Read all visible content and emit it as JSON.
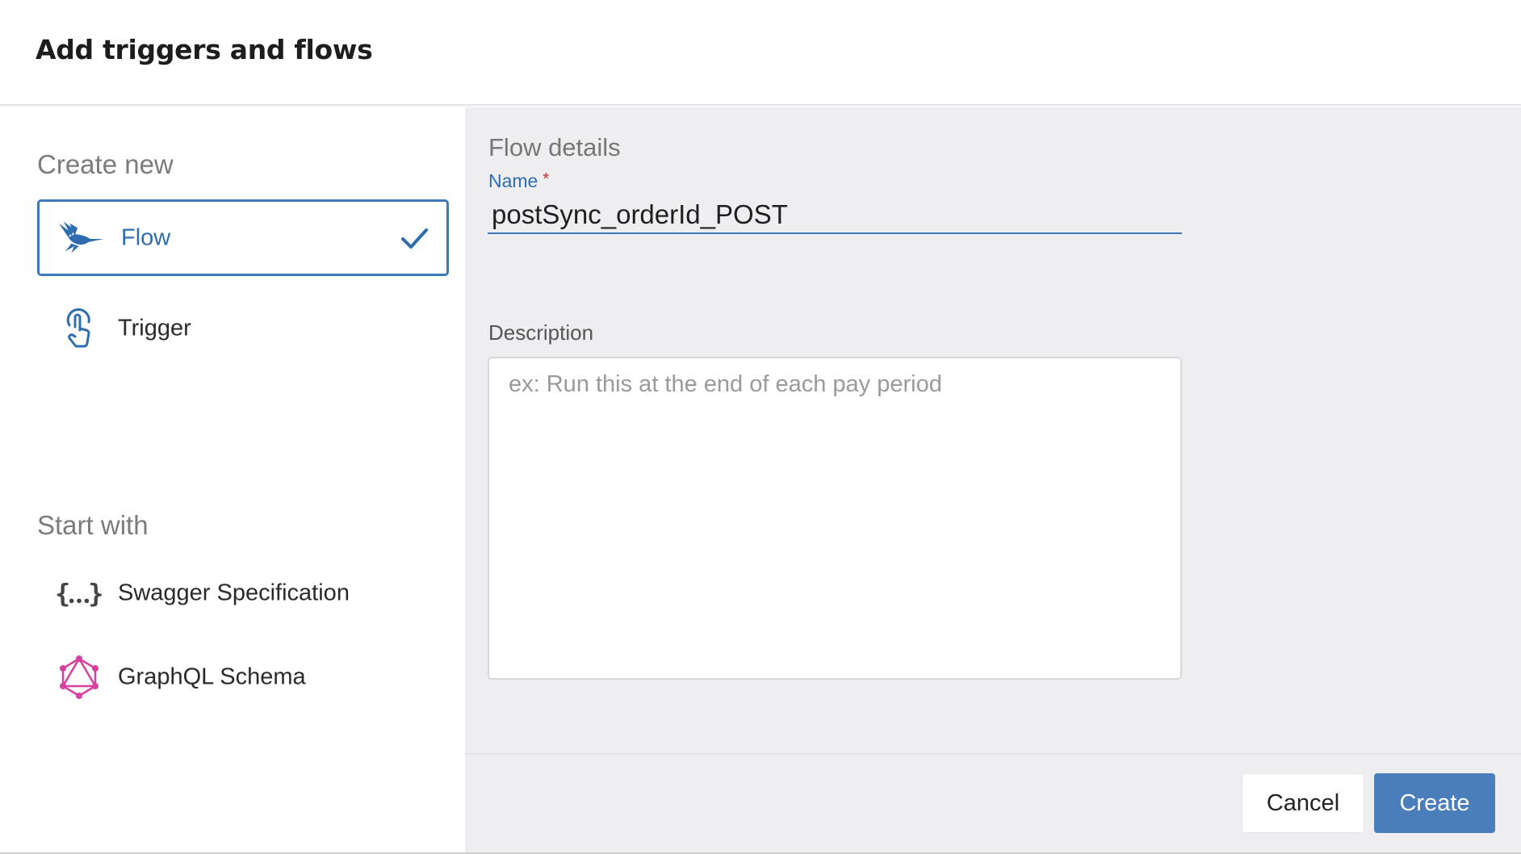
{
  "dialog": {
    "title": "Add triggers and flows"
  },
  "left": {
    "create_new_heading": "Create new",
    "create_options": [
      {
        "label": "Flow",
        "icon": "hummingbird-icon",
        "selected": true
      },
      {
        "label": "Trigger",
        "icon": "touch-trigger-icon",
        "selected": false
      }
    ],
    "start_with_heading": "Start with",
    "start_options": [
      {
        "label": "Swagger Specification",
        "icon": "swagger-braces-icon"
      },
      {
        "label": "GraphQL Schema",
        "icon": "graphql-icon"
      }
    ]
  },
  "form": {
    "heading": "Flow details",
    "name_label": "Name",
    "name_required_mark": "*",
    "name_value": "postSync_orderId_POST",
    "description_label": "Description",
    "description_placeholder": "ex: Run this at the end of each pay period",
    "description_value": ""
  },
  "footer": {
    "cancel_label": "Cancel",
    "create_label": "Create"
  },
  "colors": {
    "accent": "#3d78b8",
    "primary_button": "#4a7ebb",
    "graphql": "#d6409f",
    "required": "#c4272b",
    "panel_bg": "#eeedef"
  }
}
